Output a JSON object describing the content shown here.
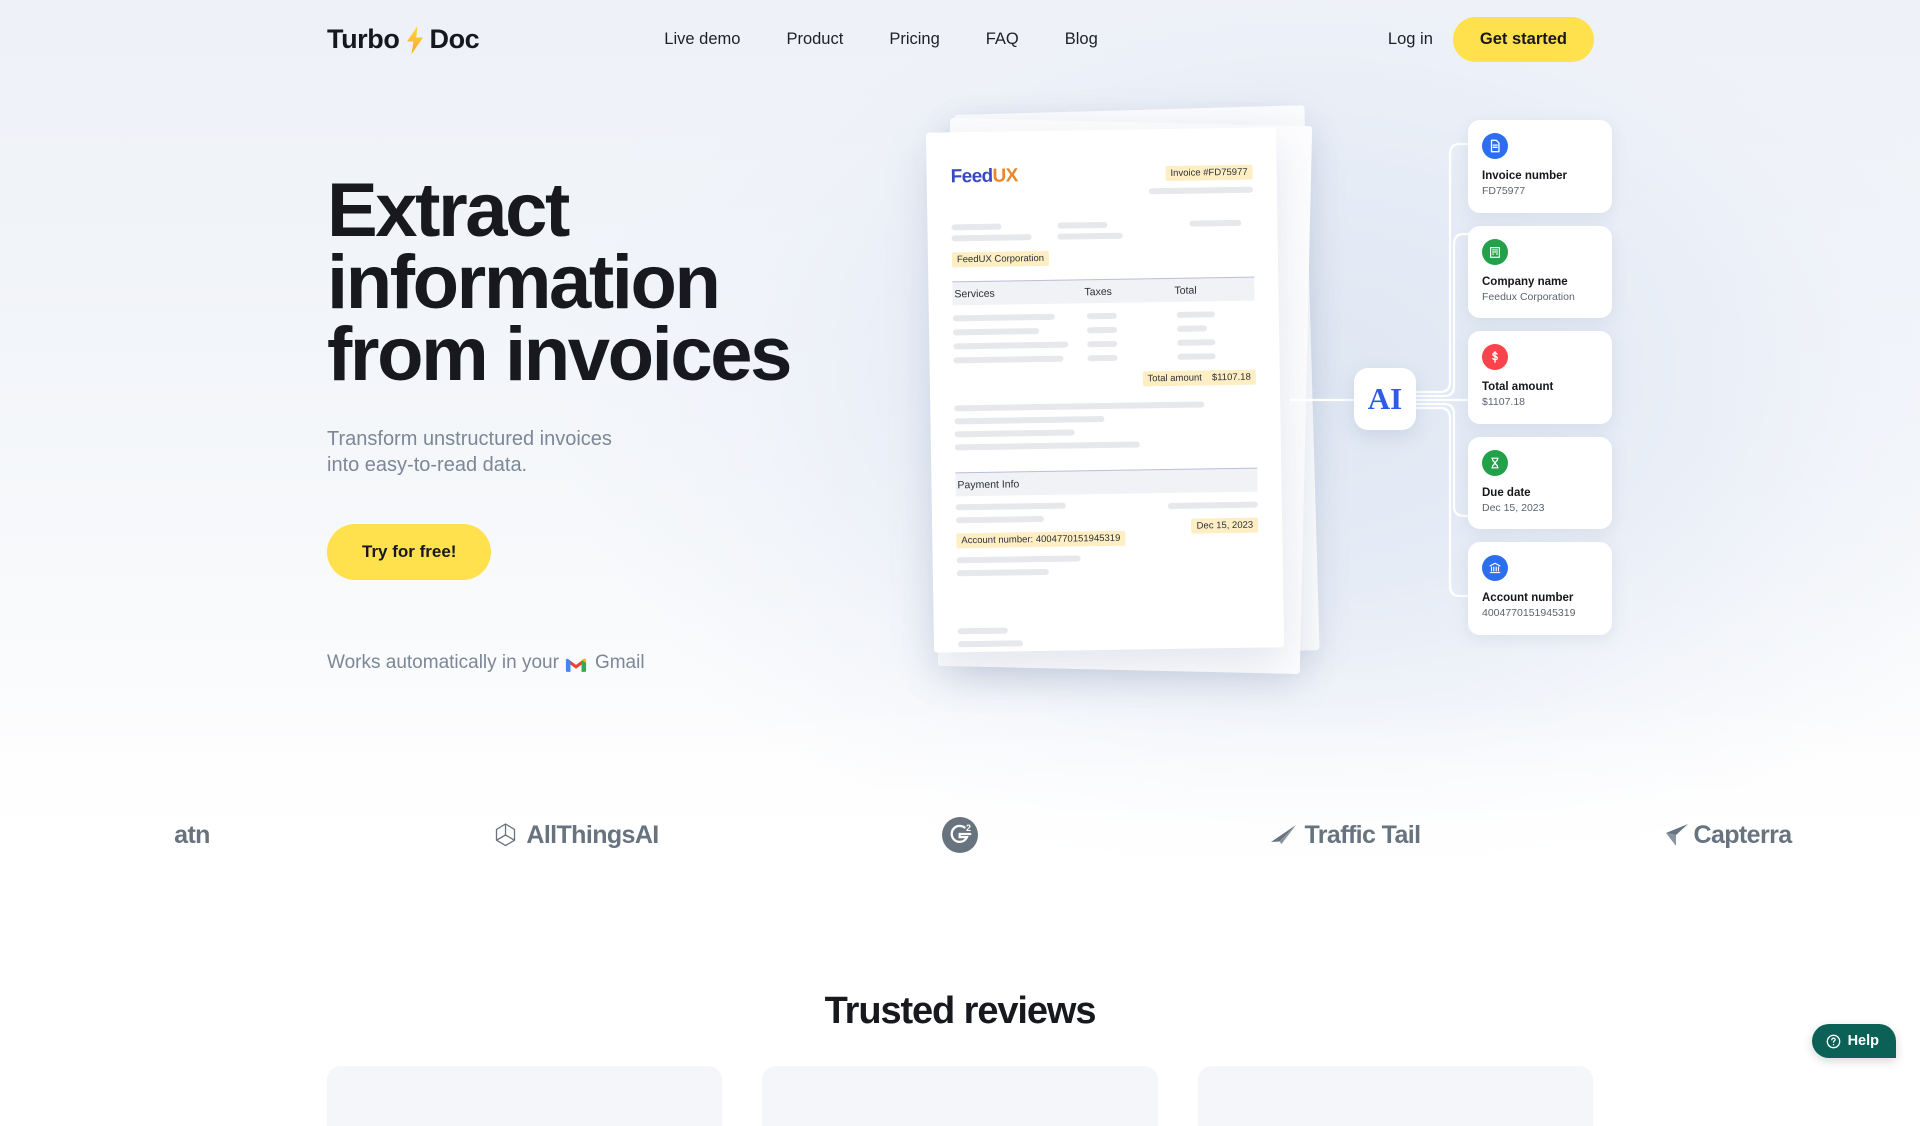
{
  "brand": {
    "name_part1": "Turbo",
    "name_part2": "Doc",
    "bolt_icon": "lightning-bolt-icon"
  },
  "nav": {
    "links": [
      {
        "label": "Live demo"
      },
      {
        "label": "Product"
      },
      {
        "label": "Pricing"
      },
      {
        "label": "FAQ"
      },
      {
        "label": "Blog"
      }
    ],
    "login_label": "Log in",
    "cta_label": "Get started",
    "cta_color": "#ffe04d"
  },
  "hero": {
    "headline_line1": "Extract",
    "headline_line2": "information",
    "headline_line3": "from invoices",
    "sub_line1": "Transform unstructured invoices",
    "sub_line2": "into easy-to-read data.",
    "cta_label": "Try for free!",
    "gmail_prefix": "Works automatically in your",
    "gmail_label": "Gmail",
    "gmail_icon": "gmail-icon"
  },
  "invoice": {
    "logo_first": "Feed",
    "logo_second": "UX",
    "invoice_number_label": "Invoice #FD75977",
    "company_label": "FeedUX Corporation",
    "table_headers": [
      "Services",
      "Taxes",
      "Total"
    ],
    "total_label": "Total amount",
    "total_value": "$1107.18",
    "payment_section": "Payment Info",
    "due_date": "Dec 15, 2023",
    "account_label": "Account number: 4004770151945319"
  },
  "ai_badge": {
    "label": "AI",
    "color": "#2f5bea"
  },
  "extracted_cards": [
    {
      "icon": "document-icon",
      "icon_color": "#2b6ef0",
      "title": "Invoice number",
      "value": "FD75977"
    },
    {
      "icon": "building-icon",
      "icon_color": "#22a04a",
      "title": "Company name",
      "value": "Feedux Corporation"
    },
    {
      "icon": "dollar-icon",
      "icon_color": "#f8444a",
      "title": "Total amount",
      "value": "$1107.18"
    },
    {
      "icon": "hourglass-icon",
      "icon_color": "#22a04a",
      "title": "Due date",
      "value": "Dec 15, 2023"
    },
    {
      "icon": "bank-icon",
      "icon_color": "#2b6ef0",
      "title": "Account number",
      "value": "4004770151945319"
    }
  ],
  "partner_logos": [
    {
      "name": "atn",
      "label": "atn",
      "icon": "atn-logo-icon"
    },
    {
      "name": "allthingsai",
      "label": "AllThingsAI",
      "icon": "allthingsai-logo-icon"
    },
    {
      "name": "g2",
      "label": "",
      "icon": "g2-logo-icon"
    },
    {
      "name": "traffictail",
      "label": "Traffic Tail",
      "icon": "traffic-tail-logo-icon"
    },
    {
      "name": "capterra",
      "label": "Capterra",
      "icon": "capterra-logo-icon"
    }
  ],
  "reviews": {
    "title": "Trusted reviews"
  },
  "help": {
    "label": "Help",
    "icon": "question-mark-icon",
    "color": "#0c6157"
  }
}
